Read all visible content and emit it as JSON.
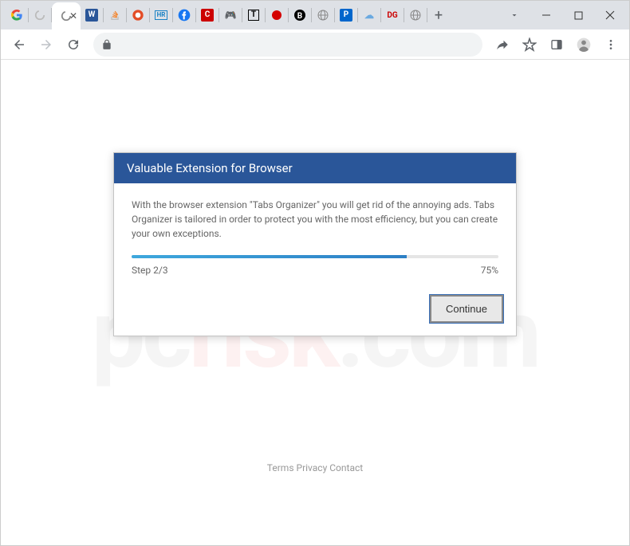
{
  "window": {
    "controls": {
      "minimize_tooltip": "Minimize",
      "maximize_tooltip": "Maximize",
      "close_tooltip": "Close"
    },
    "tab_dropdown_tooltip": "Search tabs"
  },
  "tabs": {
    "new_tab_tooltip": "New Tab",
    "items": [
      {
        "favicon": "google",
        "color": "#4285F4"
      },
      {
        "favicon": "loading",
        "color": "#888"
      },
      {
        "favicon": "close-x",
        "color": "#555",
        "active": true
      },
      {
        "favicon": "w-blue",
        "color": "#2a5699"
      },
      {
        "favicon": "stack",
        "color": "#f48024"
      },
      {
        "favicon": "red-swirl",
        "color": "#e34c26"
      },
      {
        "favicon": "hr-box",
        "color": "#1a82c5"
      },
      {
        "favicon": "facebook",
        "color": "#1877f2"
      },
      {
        "favicon": "red-c",
        "color": "#cc0000"
      },
      {
        "favicon": "controller",
        "color": "#555"
      },
      {
        "favicon": "black-t",
        "color": "#000"
      },
      {
        "favicon": "red-dot",
        "color": "#d40000"
      },
      {
        "favicon": "black-b",
        "color": "#000"
      },
      {
        "favicon": "globe",
        "color": "#888"
      },
      {
        "favicon": "p-box",
        "color": "#0066cc"
      },
      {
        "favicon": "cloud",
        "color": "#6aa9e0"
      },
      {
        "favicon": "dg-red",
        "color": "#cc0000"
      },
      {
        "favicon": "globe2",
        "color": "#888"
      }
    ]
  },
  "toolbar": {
    "back_tooltip": "Back",
    "forward_tooltip": "Forward",
    "reload_tooltip": "Reload",
    "lock_tooltip": "View site information",
    "share_tooltip": "Share",
    "bookmark_tooltip": "Bookmark",
    "panel_tooltip": "Side panel",
    "profile_tooltip": "Profile",
    "menu_tooltip": "Customize and control"
  },
  "dialog": {
    "title": "Valuable Extension for Browser",
    "description": "With the browser extension \"Tabs Organizer\" you will get rid of the annoying ads. Tabs Organizer is tailored in order to protect you with the most efficiency, but you can create your own exceptions.",
    "step_label": "Step 2/3",
    "percent_label": "75%",
    "progress_percent": 75,
    "continue_label": "Continue"
  },
  "footer": {
    "terms": "Terms",
    "privacy": "Privacy",
    "contact": "Contact"
  },
  "watermark": {
    "part1": "pc",
    "part2": "risk",
    "part3": ".com"
  }
}
